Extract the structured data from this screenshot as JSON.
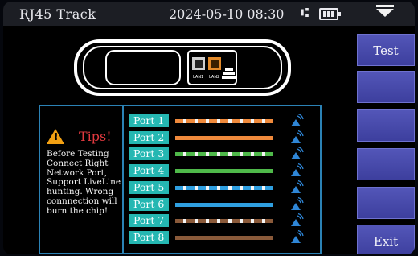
{
  "status_bar": {
    "title": "RJ45 Track",
    "datetime": "2024-05-10   08:30"
  },
  "device": {
    "port_labels": [
      "LAN1",
      "LAN2"
    ]
  },
  "buttons": {
    "test": "Test",
    "exit": "Exit"
  },
  "tips": {
    "title": "Tips!",
    "body": "Before Testing Connect Right Network Port, Support LiveLine hunting. Wrong connnection will burn the chip!"
  },
  "ports": [
    {
      "label": "Port 1",
      "color": "#f08a3c",
      "striped": true
    },
    {
      "label": "Port 2",
      "color": "#f08a3c",
      "striped": false
    },
    {
      "label": "Port 3",
      "color": "#4fb94a",
      "striped": true
    },
    {
      "label": "Port 4",
      "color": "#4fb94a",
      "striped": false
    },
    {
      "label": "Port 5",
      "color": "#2f9fe0",
      "striped": true
    },
    {
      "label": "Port 6",
      "color": "#2f9fe0",
      "striped": false
    },
    {
      "label": "Port 7",
      "color": "#8a5a3a",
      "striped": true
    },
    {
      "label": "Port 8",
      "color": "#8a5a3a",
      "striped": false
    }
  ],
  "colors": {
    "accent_button": "#4a4caf",
    "panel_border": "#2b82b5",
    "port_label_bg": "#25b7b2",
    "tips_title": "#e0393f",
    "warning": "#f2a013"
  },
  "icons": {
    "status": [
      "usb-icon",
      "battery-icon",
      "menu-icon"
    ],
    "row": "network-signal-icon"
  }
}
